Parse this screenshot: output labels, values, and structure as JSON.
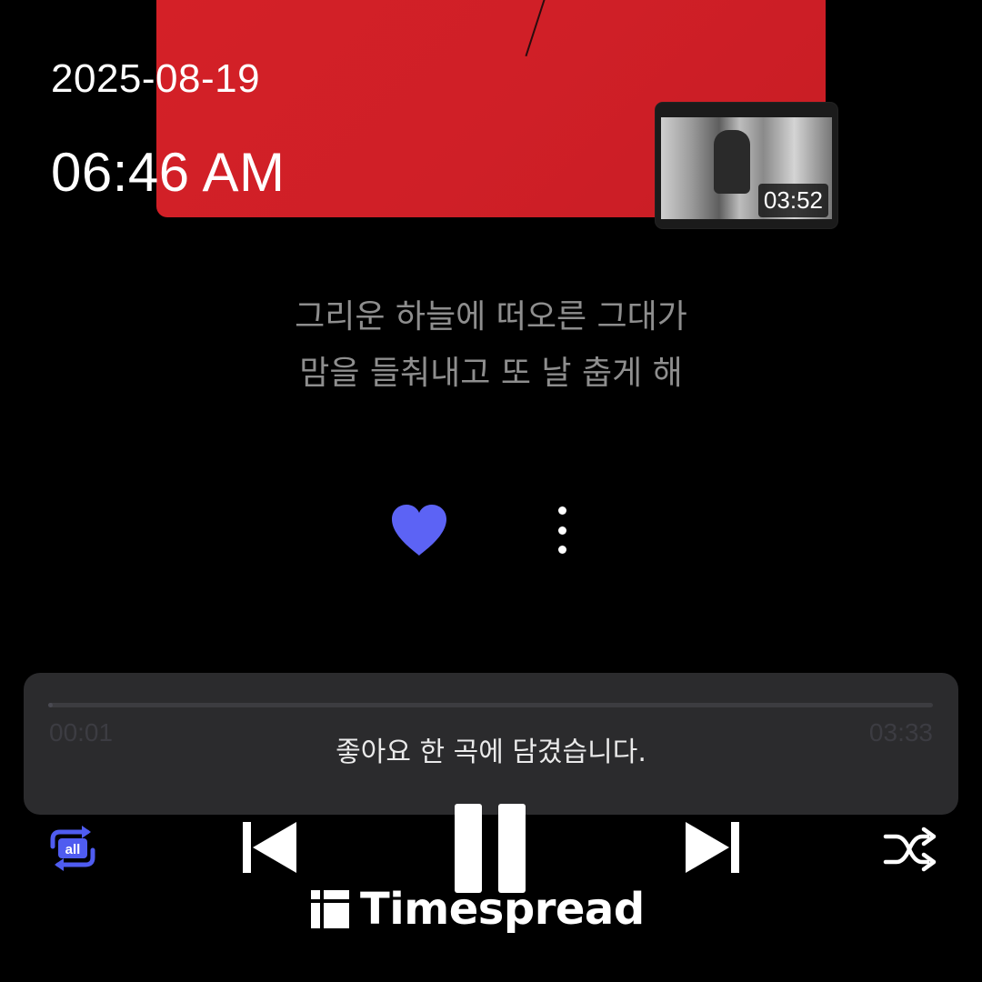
{
  "timestamp": {
    "date": "2025-08-19",
    "time": "06:46 AM"
  },
  "video_thumbnail": {
    "duration": "03:52"
  },
  "lyrics": {
    "line1": "그리운 하늘에 떠오른 그대가",
    "line2": "맘을 들춰내고 또 날 춥게 해"
  },
  "actions": {
    "like_icon": "heart-icon",
    "like_color": "#5c63f5",
    "more_icon": "more-vertical-icon"
  },
  "progress": {
    "elapsed": "00:01",
    "total": "03:33",
    "fraction": 0.005
  },
  "toast": {
    "message": "좋아요 한 곡에 담겼습니다."
  },
  "controls": {
    "repeat": {
      "icon": "repeat-all-icon",
      "badge": "all",
      "color": "#4f5cf0"
    },
    "previous_icon": "skip-previous-icon",
    "play_pause_icon": "pause-icon",
    "next_icon": "skip-next-icon",
    "shuffle_icon": "shuffle-icon"
  },
  "watermark": {
    "brand": "Timespread"
  }
}
